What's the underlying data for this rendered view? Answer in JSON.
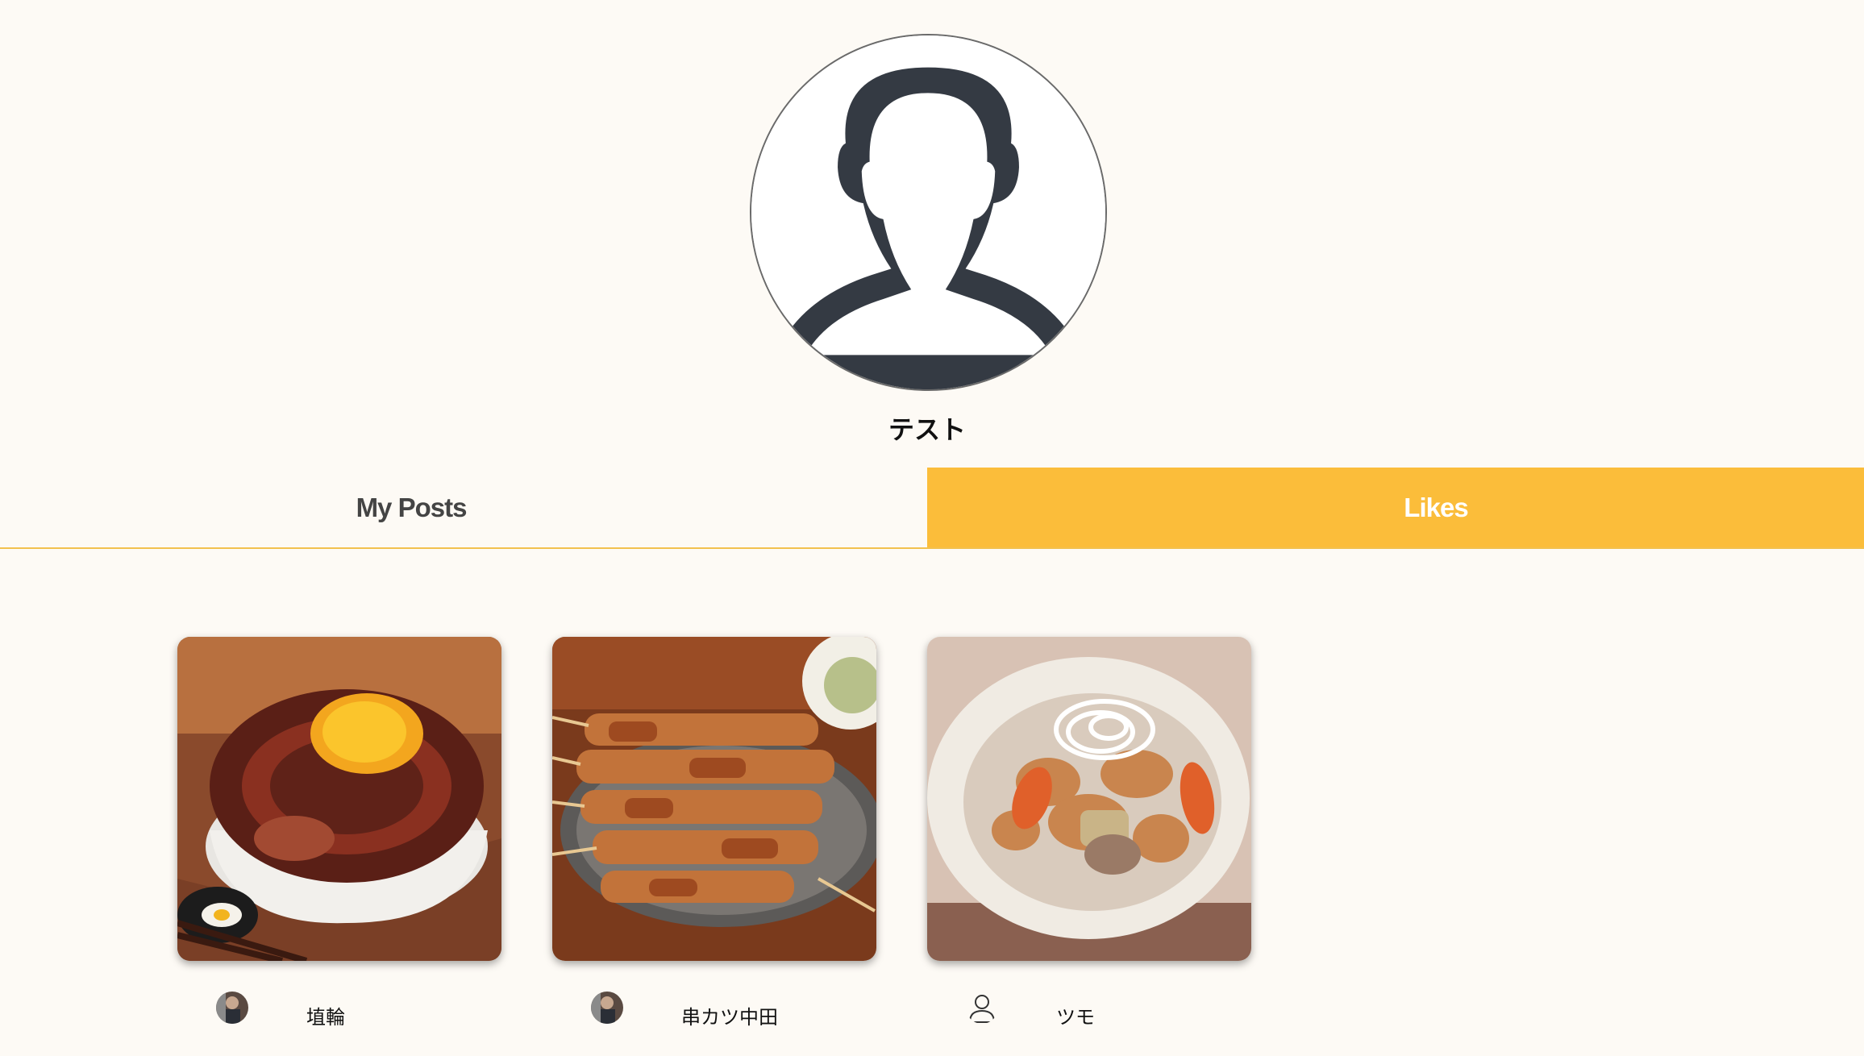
{
  "profile": {
    "username": "テスト",
    "avatar_icon": "person-silhouette-icon"
  },
  "tabs": [
    {
      "label": "My Posts",
      "active": false
    },
    {
      "label": "Likes",
      "active": true
    }
  ],
  "colors": {
    "background": "#fdfaf5",
    "accent": "#fbbd3a",
    "silhouette": "#343a43"
  },
  "posts": [
    {
      "image": "sausage-egg-rice-bowl-photo",
      "user": "埴輪",
      "avatar": "user-photo-avatar"
    },
    {
      "image": "kushikatsu-skewers-photo",
      "user": "串カツ中田",
      "avatar": "user-photo-avatar"
    },
    {
      "image": "motsuni-stew-bowl-photo",
      "user": "ツモ",
      "avatar": "default-user-icon"
    }
  ]
}
